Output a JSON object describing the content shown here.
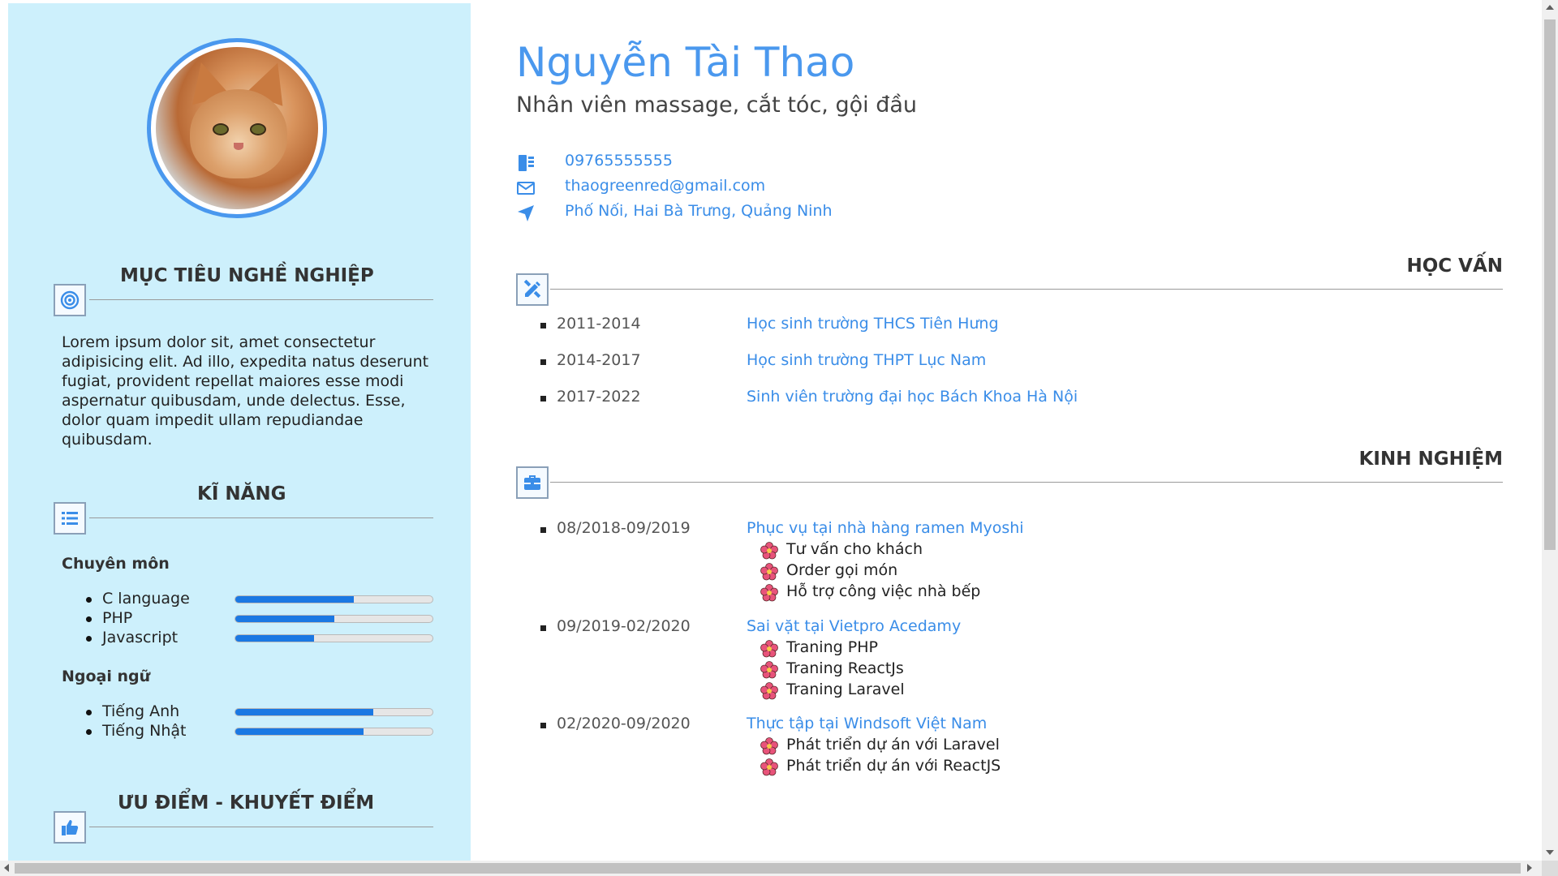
{
  "profile": {
    "name": "Nguyễn Tài Thao",
    "job": "Nhân viên massage, cắt tóc, gội đầu",
    "contacts": [
      {
        "icon": "phone-icon",
        "text": "09765555555"
      },
      {
        "icon": "envelope-icon",
        "text": "thaogreenred@gmail.com"
      },
      {
        "icon": "location-arrow-icon",
        "text": "Phố Nối, Hai Bà Trưng, Quảng Ninh"
      }
    ]
  },
  "sidebar": {
    "objective": {
      "title": "MỤC TIÊU NGHỀ NGHIỆP",
      "icon": "target-icon",
      "text": "Lorem ipsum dolor sit, amet consectetur adipisicing elit. Ad illo, expedita natus deserunt fugiat, provident repellat maiores esse modi aspernatur quibusdam, unde delectus. Esse, dolor quam impedit ullam repudiandae quibusdam."
    },
    "skills": {
      "title": "KĨ NĂNG",
      "icon": "list-icon",
      "professional_title": "Chuyên môn",
      "professional": [
        {
          "label": "C language",
          "level": 0.6
        },
        {
          "label": "PHP",
          "level": 0.5
        },
        {
          "label": "Javascript",
          "level": 0.4
        }
      ],
      "language_title": "Ngoại ngữ",
      "languages": [
        {
          "label": "Tiếng Anh",
          "level": 0.7
        },
        {
          "label": "Tiếng Nhật",
          "level": 0.65
        }
      ]
    },
    "strengths": {
      "title": "ƯU ĐIỂM - KHUYẾT ĐIỂM",
      "icon": "thumbs-up-icon"
    }
  },
  "education": {
    "title": "HỌC VẤN",
    "icon": "pencil-ruler-icon",
    "items": [
      {
        "years": "2011-2014",
        "text": "Học sinh trường THCS Tiên Hưng"
      },
      {
        "years": "2014-2017",
        "text": "Học sinh trường THPT Lục Nam"
      },
      {
        "years": "2017-2022",
        "text": "Sinh viên trường đại học Bách Khoa Hà Nội"
      }
    ]
  },
  "experience": {
    "title": "KINH NGHIỆM",
    "icon": "briefcase-icon",
    "items": [
      {
        "period": "08/2018-09/2019",
        "title": "Phục vụ tại nhà hàng ramen Myoshi",
        "tasks": [
          "Tư vấn cho khách",
          "Order gọi món",
          "Hỗ trợ công việc nhà bếp"
        ]
      },
      {
        "period": "09/2019-02/2020",
        "title": "Sai vặt tại Vietpro Acedamy",
        "tasks": [
          "Traning PHP",
          "Traning ReactJs",
          "Traning Laravel"
        ]
      },
      {
        "period": "02/2020-09/2020",
        "title": "Thực tập tại Windsoft Việt Nam",
        "tasks": [
          "Phát triển dự án với Laravel",
          "Phát triển dự án với ReactJS"
        ]
      }
    ]
  },
  "colors": {
    "accent": "#4a98ee",
    "sidebar_bg": "#cdf0fc",
    "skill_fill": "#1a78e3"
  }
}
